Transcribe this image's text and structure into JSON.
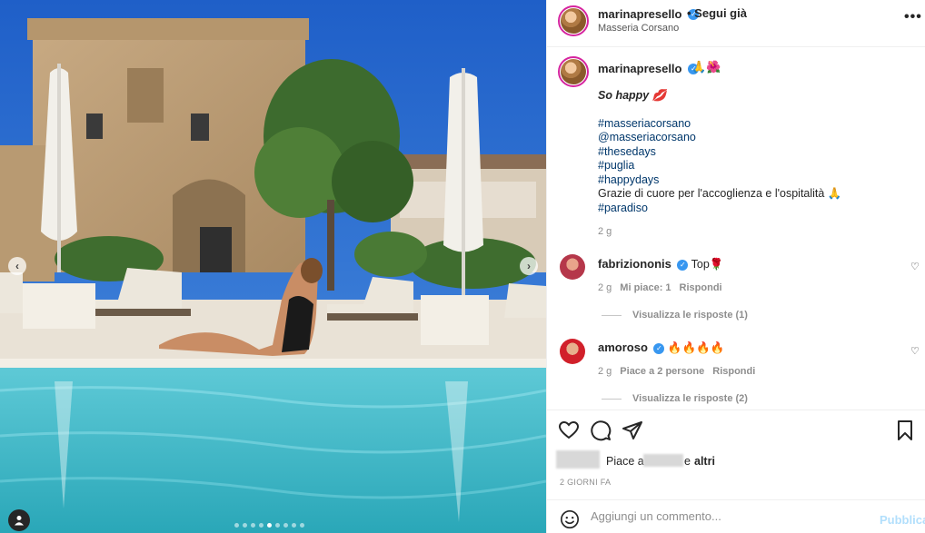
{
  "post": {
    "username": "marinapresello",
    "follow_label": "• Segui già",
    "location": "Masseria Corsano",
    "more_label": "•••"
  },
  "caption": {
    "username": "marinapresello",
    "emoji": "🙏🌺",
    "line1": "So happy 💋",
    "lines": [
      "#masseriacorsano",
      "@masseriacorsano",
      "#thesedays",
      "#puglia",
      "#happydays"
    ],
    "thanks": "Grazie di cuore per l'accoglienza e l'ospitalità 🙏",
    "last_tag": "#paradiso",
    "time": "2 g"
  },
  "comments": [
    {
      "username": "fabriziononis",
      "text": "Top🌹",
      "time": "2 g",
      "likes": "Mi piace: 1",
      "reply": "Rispondi",
      "view_replies": "Visualizza le risposte (1)"
    },
    {
      "username": "amoroso",
      "text": "🔥🔥🔥🔥",
      "time": "2 g",
      "likes": "Piace a 2 persone",
      "reply": "Rispondi",
      "view_replies": "Visualizza le risposte (2)"
    }
  ],
  "likes_summary": {
    "prefix": "Piace a",
    "suffix": "e",
    "others": "altri"
  },
  "date": "2 GIORNI FA",
  "add_comment": {
    "placeholder": "Aggiungi un commento...",
    "publish_label": "Pubblica"
  },
  "carousel": {
    "prev": "‹",
    "next": "›",
    "dot_count": 9,
    "active_index": 4
  },
  "icons": {
    "like": "heart-icon",
    "comment": "comment-icon",
    "share": "share-icon",
    "save": "bookmark-icon",
    "emoji": "emoji-icon",
    "tag": "user-tag-icon"
  },
  "colors": {
    "verified": "#3897f0",
    "publish": "#b2dffc",
    "link": "#00376b"
  }
}
